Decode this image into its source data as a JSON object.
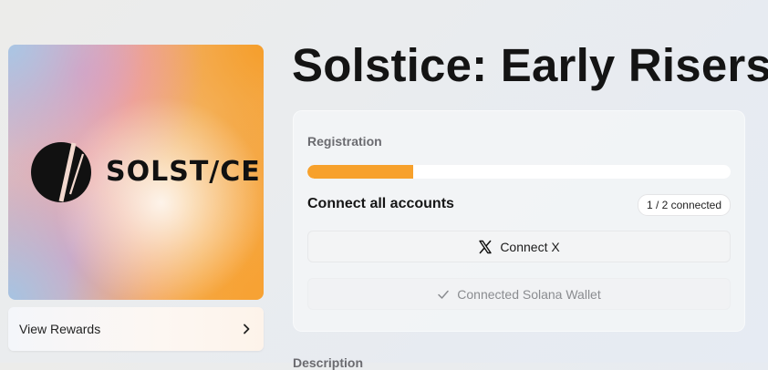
{
  "hero": {
    "brand_word": "SOLST/CE",
    "logo_icon": "solstice-logo-icon"
  },
  "rewards": {
    "label": "View Rewards",
    "icon": "chevron-right-icon"
  },
  "page": {
    "title": "Solstice: Early Risers"
  },
  "registration": {
    "label": "Registration",
    "progress_fraction": 0.25,
    "connect_heading": "Connect all accounts",
    "connected_count": "1 / 2 connected",
    "connect_x_label": "Connect X",
    "connect_x_icon": "x-logo-icon",
    "wallet_label": "Connected Solana Wallet",
    "wallet_icon": "checkmark-icon"
  },
  "description": {
    "heading": "Description"
  },
  "colors": {
    "accent": "#f7a12c",
    "title_text": "#141414",
    "muted_text": "#6b6b70"
  }
}
